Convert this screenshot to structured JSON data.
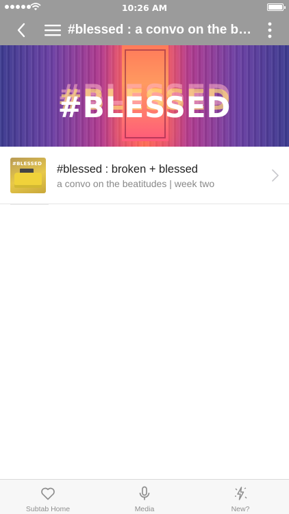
{
  "status_bar": {
    "time": "10:26 AM",
    "signal_dots": 5
  },
  "nav": {
    "title": "#blessed : a convo on the beatitudes",
    "back_icon": "chevron-left-icon",
    "menu_icon": "hamburger-menu-icon",
    "more_icon": "more-vertical-icon"
  },
  "hero": {
    "text": "#BLESSED"
  },
  "items": [
    {
      "title": "#blessed : broken + blessed",
      "subtitle": "a convo on the beatitudes | week two",
      "thumb_text": "#BLESSED"
    }
  ],
  "tabs": [
    {
      "label": "Subtab Home",
      "icon": "heart-icon"
    },
    {
      "label": "Media",
      "icon": "microphone-icon"
    },
    {
      "label": "New?",
      "icon": "sparkle-bolt-icon"
    }
  ],
  "colors": {
    "bar": "#9b9b9b",
    "tab_inactive": "#8e8e8e"
  }
}
